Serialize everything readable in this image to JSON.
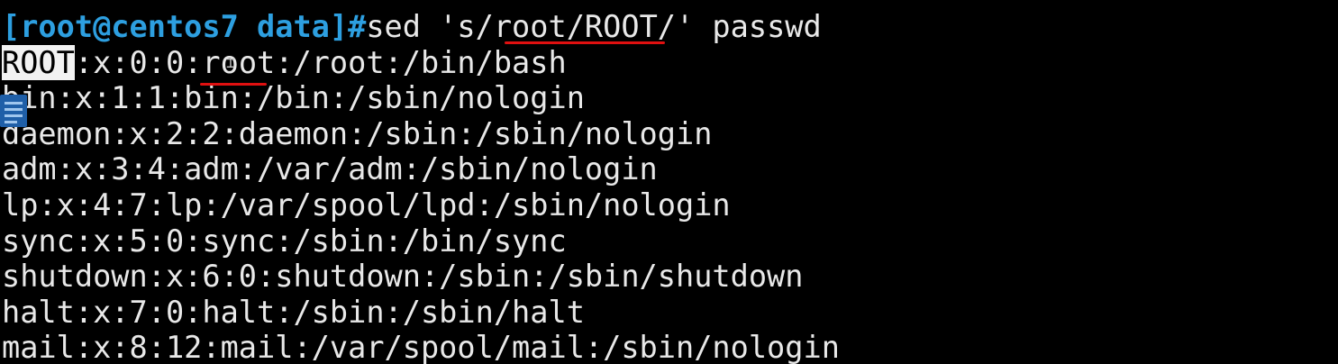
{
  "terminal": {
    "prompt": "[root@centos7 data]#",
    "command": "sed 's/root/ROOT/' passwd",
    "top_fragment": "1"
  },
  "output": {
    "line1_highlight": "ROOT",
    "line1_rest": ":x:0:0:root:/root:/bin/bash",
    "lines": [
      "bin:x:1:1:bin:/bin:/sbin/nologin",
      "daemon:x:2:2:daemon:/sbin:/sbin/nologin",
      "adm:x:3:4:adm:/var/adm:/sbin/nologin",
      "lp:x:4:7:lp:/var/spool/lpd:/sbin/nologin",
      "sync:x:5:0:sync:/sbin:/bin/sync",
      "shutdown:x:6:0:shutdown:/sbin:/sbin/shutdown",
      "halt:x:7:0:halt:/sbin:/sbin/halt",
      "mail:x:8:12:mail:/var/spool/mail:/sbin/nologin"
    ]
  },
  "colors": {
    "background": "#000000",
    "text": "#e8e8e8",
    "prompt": "#2d9fe0",
    "annotation_underline": "#e01010",
    "selection": "#f2f2f2"
  },
  "icons": {
    "cursor": "ibeam-cursor-icon",
    "overlay": "document-icon"
  }
}
